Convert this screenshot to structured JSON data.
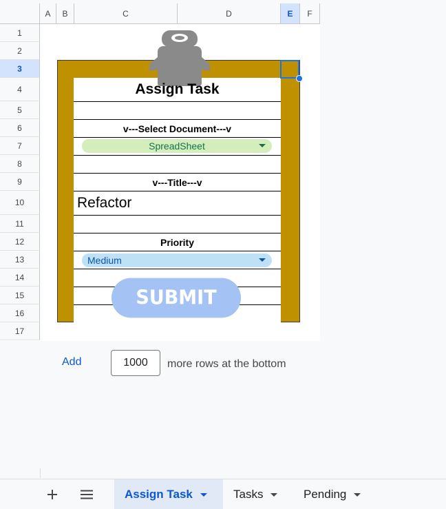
{
  "columns": [
    "A",
    "B",
    "C",
    "D",
    "E",
    "F"
  ],
  "rows": [
    "1",
    "2",
    "3",
    "4",
    "5",
    "6",
    "7",
    "8",
    "9",
    "10",
    "11",
    "12",
    "13",
    "14",
    "15",
    "16",
    "17"
  ],
  "selected_cell": {
    "column": "E",
    "row": "3"
  },
  "form": {
    "title": "Assign Task",
    "document_label": "v---Select Document---v",
    "document_value": "SpreadSheet",
    "title_label": "v---Title---v",
    "title_value": "Refactor",
    "priority_label": "Priority",
    "priority_value": "Medium",
    "submit_label": "SUBMIT"
  },
  "add_rows": {
    "link_label": "Add",
    "count": "1000",
    "suffix": "more rows at the bottom"
  },
  "sheet_tabs": [
    {
      "label": "Assign Task",
      "active": true
    },
    {
      "label": "Tasks",
      "active": false
    },
    {
      "label": "Pending",
      "active": false
    }
  ],
  "colors": {
    "board": "#bf9000",
    "document_chip": "#d4edbc",
    "priority_chip": "#bfe1f6",
    "submit": "#a4c2f4",
    "selection": "#1a73e8"
  },
  "icons": [
    "clipboard-clip-icon",
    "add-sheet-icon",
    "all-sheets-menu-icon",
    "chevron-down-icon"
  ]
}
